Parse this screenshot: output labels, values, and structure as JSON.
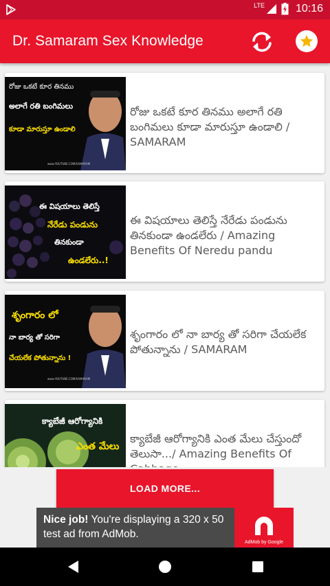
{
  "status_bar": {
    "network_label": "LTE",
    "time": "10:16"
  },
  "app_bar": {
    "title": "Dr. Samaram Sex Knowledge",
    "accent_color": "#e8152b"
  },
  "articles": [
    {
      "title": "రోజు ఒకటే కూర తినము అలాగే రతి బంగిమలు కూడా మారుస్తూ ఉండాలి / SAMARAM",
      "thumb_lines": [
        "రోజు ఒకటే కూర తినము",
        "అలాగే రతి బంగిమలు",
        "కూడా మారుస్తూ ఉండాలి"
      ],
      "thumb_caption": "www.YOUTUBE.COM/SAMARAM"
    },
    {
      "title": "ఈ విషయాలు తెలిస్తే నేరేడు పండును తినకుండా ఉండలేరు / Amazing Benefits Of Neredu pandu",
      "thumb_lines": [
        "ఈ విషయాలు తెలిస్తే",
        "నేరేడు పండును",
        "తినకుండా",
        "ఉండలేరు..!"
      ],
      "thumb_caption": ""
    },
    {
      "title": "శృంగారం లో నా బార్య తో సరిగా చేయలేక పోతున్నాను / SAMARAM",
      "thumb_lines": [
        "శృంగారం లో",
        "నా బార్య తో సరిగా",
        "చేయలేక పోతున్నాను !"
      ],
      "thumb_caption": "www.YOUTUBE.COM/SAMARAM"
    },
    {
      "title": "క్యాబేజీ ఆరోగ్యానికి ఎంత మేలు చేస్తుందో తెలుసా.../ Amazing Benefits Of Cabbage",
      "thumb_lines": [
        "క్యాబేజీ ఆరోగ్యానికి",
        "ఎంత మేలు"
      ],
      "thumb_caption": ""
    }
  ],
  "load_more_label": "LOAD MORE...",
  "ad": {
    "headline": "Nice job!",
    "body": " You're displaying a 320 x 50 test ad from AdMob.",
    "brand_caption": "AdMob by Google"
  },
  "icons": {
    "play_store": "play-store-icon",
    "signal": "signal-icon",
    "battery": "battery-icon",
    "refresh": "refresh-icon",
    "star": "star-icon",
    "back": "back-icon",
    "home": "home-icon",
    "recents": "recents-icon"
  }
}
